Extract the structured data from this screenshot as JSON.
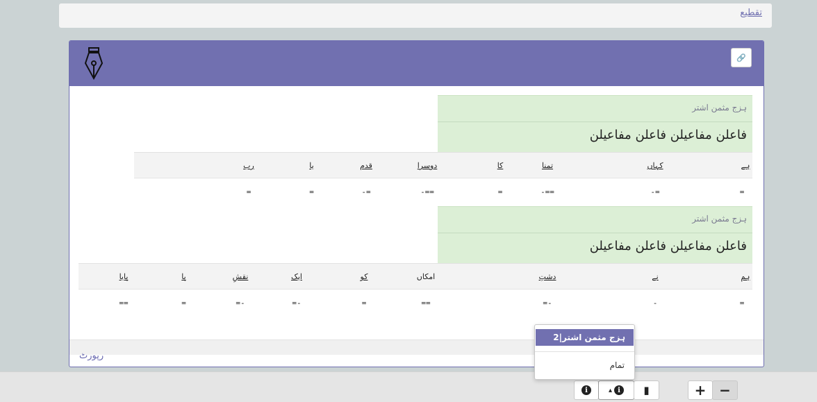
{
  "top_bar": {
    "link_text": "تقطیع"
  },
  "card": {
    "icons": {
      "header": "fountain-pen-nib-icon",
      "link": "chain-link-icon"
    },
    "link_glyph": "🔗",
    "section1": {
      "meter_name": "ہزج مثمن اشتر",
      "feet": "فاعلن مفاعیلن فاعلن مفاعیلن",
      "words": [
        "ہے",
        "کہاں",
        "تمنا",
        "کا",
        "دوسرا",
        "قدم",
        "یا",
        "رب"
      ],
      "scansion": [
        "=",
        "-=",
        "-==",
        "=",
        "-==",
        "-=",
        "=",
        "="
      ]
    },
    "section2": {
      "meter_name": "ہزج مثمن اشتر",
      "feet": "فاعلن مفاعیلن فاعلن مفاعیلن",
      "words": [
        "ہم",
        "نے",
        "دشتِ",
        "امکاں",
        "کو",
        "ایک",
        "نقشِ",
        "پا",
        "پایا"
      ],
      "scansion": [
        "=",
        "-",
        "=-",
        "==",
        "=",
        "=-",
        "=-",
        "=",
        "=="
      ]
    }
  },
  "report_link": "رپورٹ",
  "dropdown": {
    "selected": "ہزج مثمن اشتر|2",
    "other": "تمام"
  },
  "bottom_bar": {
    "info_icon": "info-circle-icon",
    "info_glyph": "i",
    "info_caret": "▴",
    "book_icon": "book-icon",
    "book_glyph": "▮",
    "plus": "+",
    "minus": "−"
  }
}
